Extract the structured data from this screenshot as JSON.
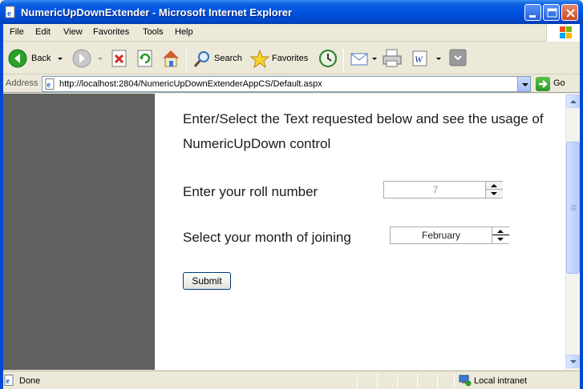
{
  "window": {
    "title": "NumericUpDownExtender - Microsoft Internet Explorer"
  },
  "menu": {
    "items": [
      "File",
      "Edit",
      "View",
      "Favorites",
      "Tools",
      "Help"
    ]
  },
  "toolbar": {
    "back_label": "Back",
    "search_label": "Search",
    "favorites_label": "Favorites"
  },
  "address": {
    "label": "Address",
    "url": "http://localhost:2804/NumericUpDownExtenderAppCS/Default.aspx",
    "go_label": "Go"
  },
  "page": {
    "intro": "Enter/Select the Text requested below and see the usage of NumericUpDown control",
    "roll": {
      "label": "Enter your roll number",
      "value": "7"
    },
    "month": {
      "label": "Select your month of joining",
      "value": "February"
    },
    "submit_label": "Submit"
  },
  "status": {
    "text": "Done",
    "zone": "Local intranet"
  },
  "colors": {
    "titlebar": "#0054e3",
    "sidebar": "#5f615f",
    "content_bg": "#ffffff",
    "chrome": "#ece9d8"
  },
  "icons": {
    "title": "ie-page-icon",
    "back": "back-arrow-icon",
    "forward": "forward-arrow-icon",
    "stop": "stop-icon",
    "refresh": "refresh-icon",
    "home": "home-icon",
    "search": "search-icon",
    "favorites": "star-icon",
    "history": "history-icon",
    "mail": "mail-icon",
    "print": "print-icon",
    "edit": "word-icon",
    "messenger": "messenger-icon",
    "go": "go-arrow-icon",
    "zone": "intranet-icon",
    "status": "page-done-icon"
  }
}
